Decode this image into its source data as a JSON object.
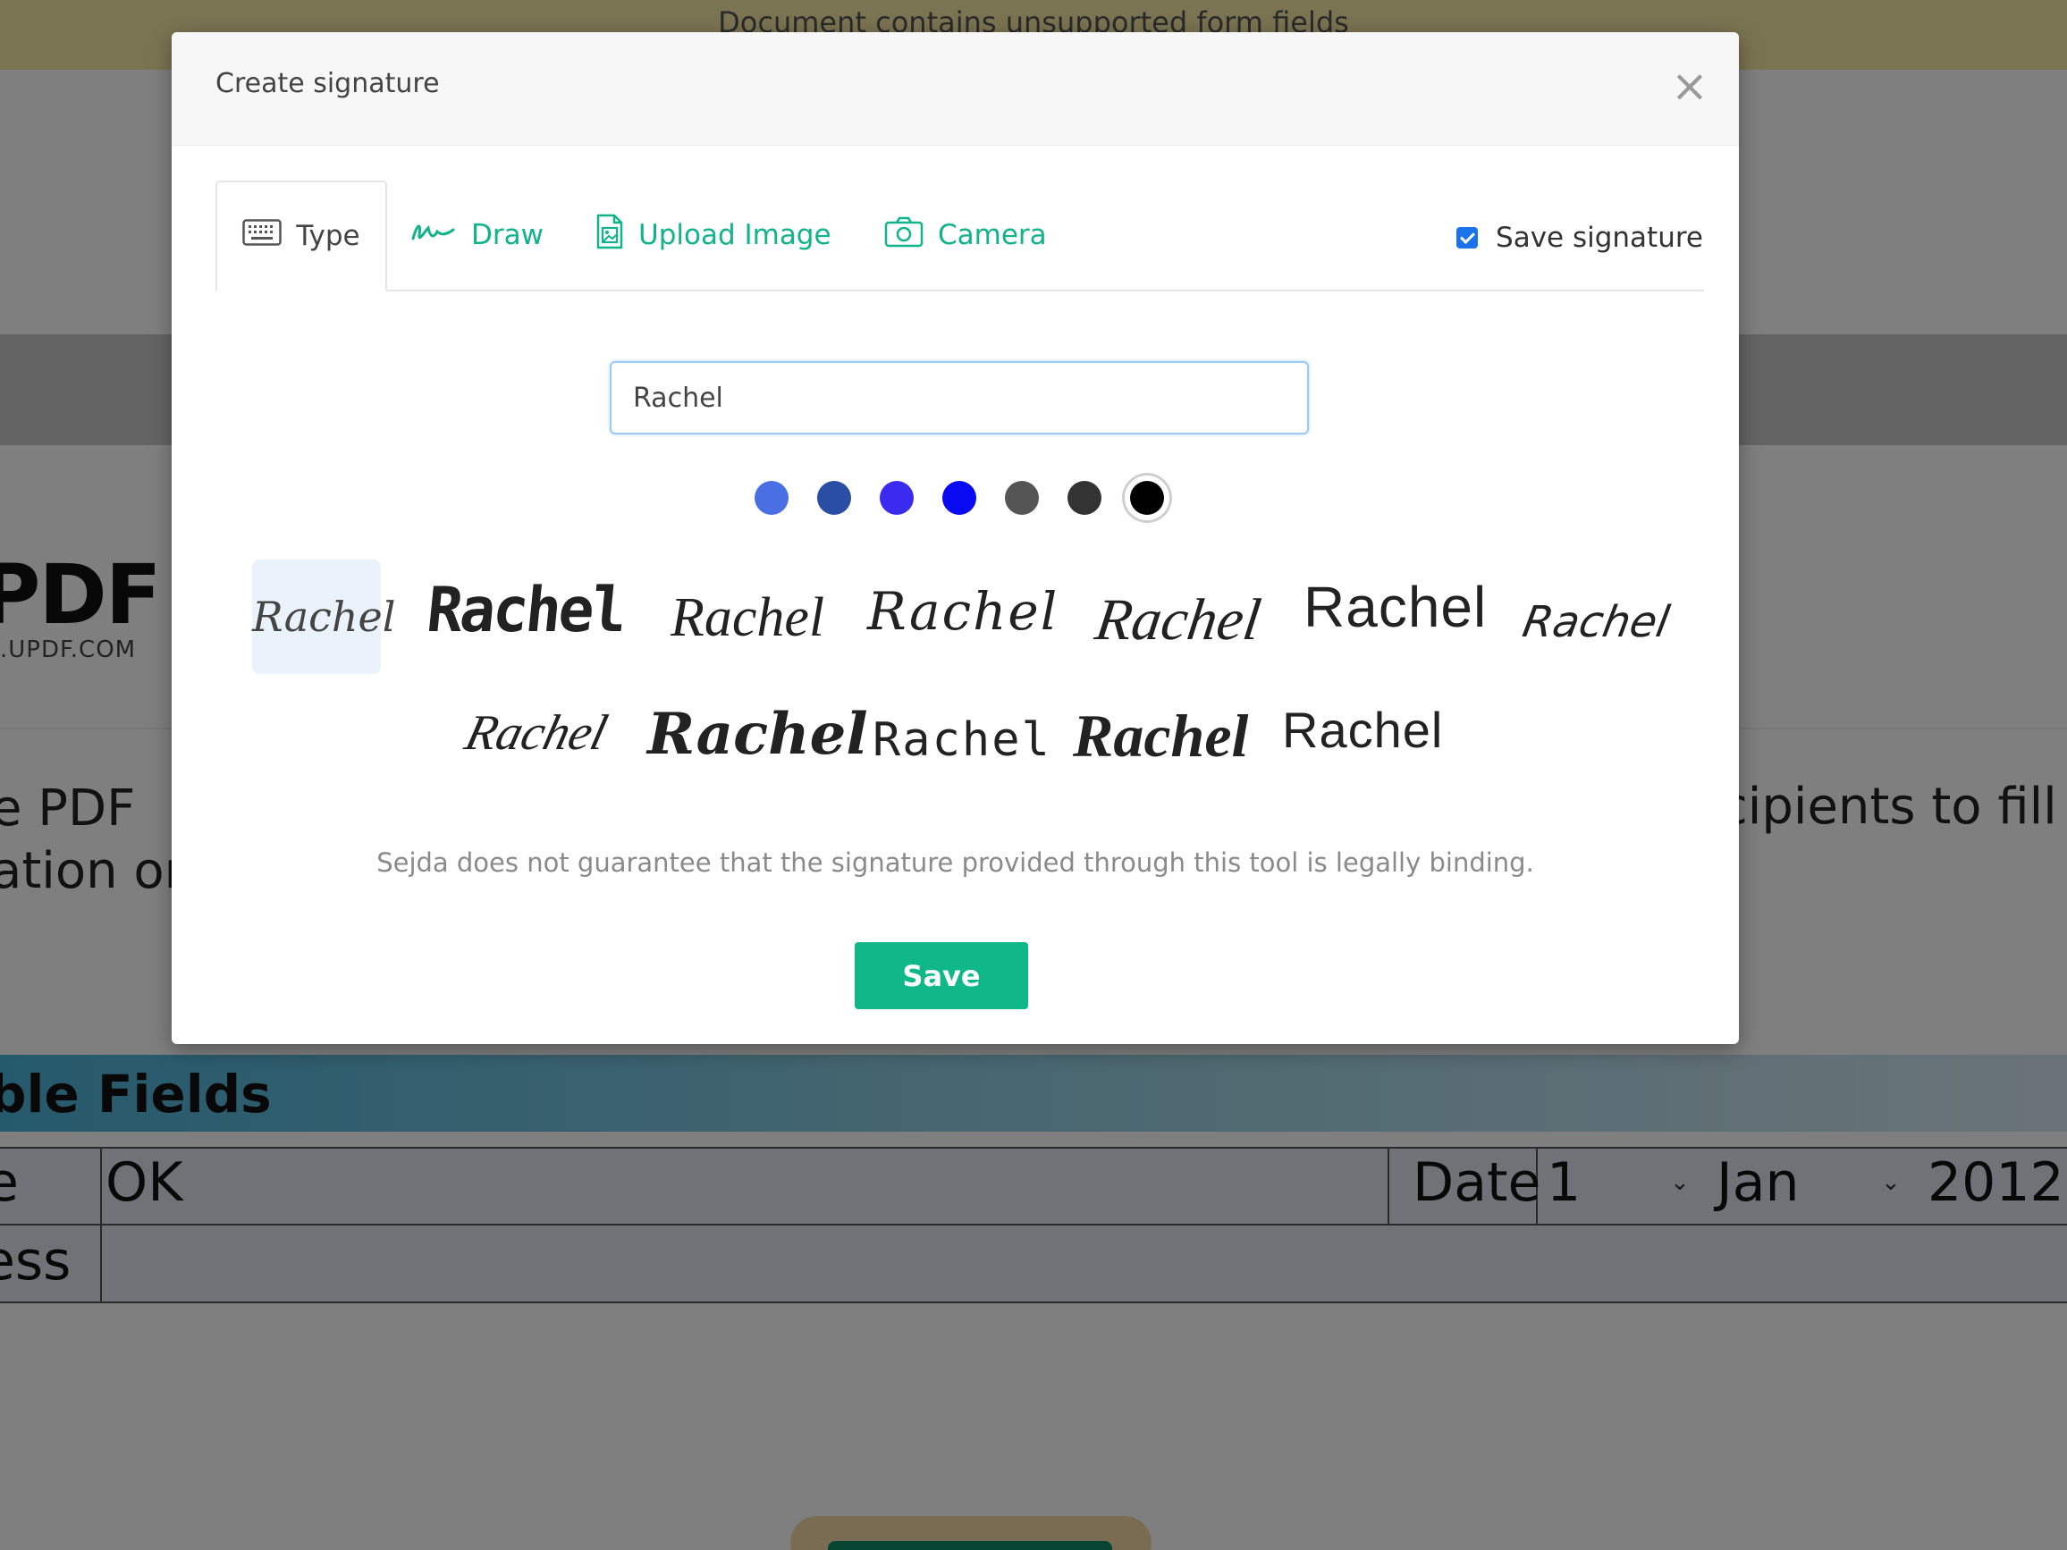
{
  "background": {
    "banner_text": "Document contains unsupported form fields",
    "logo_title": "PDF",
    "logo_subtitle": ".UPDF.COM",
    "para_left_line1": "e  PDF",
    "para_left_line2": "ation or",
    "para_right": "cipients  to  fill",
    "fields_title": "ble Fields",
    "row1_label": "e",
    "row1_value": "OK",
    "date_label": "Date",
    "day_value": "1",
    "month_value": "Jan",
    "year_value": "2012",
    "row2_label": "ess"
  },
  "modal": {
    "title": "Create signature",
    "close_symbol": "×",
    "tabs": [
      {
        "label": "Type",
        "icon": "keyboard-icon",
        "active": true
      },
      {
        "label": "Draw",
        "icon": "signature-icon",
        "active": false
      },
      {
        "label": "Upload Image",
        "icon": "image-file-icon",
        "active": false
      },
      {
        "label": "Camera",
        "icon": "camera-icon",
        "active": false
      }
    ],
    "save_signature_label": "Save signature",
    "save_signature_checked": true,
    "name_input_value": "Rachel",
    "colors": [
      "#4a6fe3",
      "#2b4ea5",
      "#3b2bf0",
      "#0a0af2",
      "#555555",
      "#333333",
      "#000000"
    ],
    "selected_color": "#000000",
    "signature_text": "Rachel",
    "signature_samples": [
      "Rachel",
      "Rachel",
      "Rachel",
      "Rachel",
      "Rachel",
      "Rachel",
      "Rachel",
      "Rachel",
      "Rachel",
      "Rachel",
      "Rachel",
      "Rachel"
    ],
    "selected_signature_index": 0,
    "disclaimer": "Sejda does not guarantee that the signature provided through this tool is legally binding.",
    "save_button_label": "Save",
    "accent_color": "#10b889"
  }
}
